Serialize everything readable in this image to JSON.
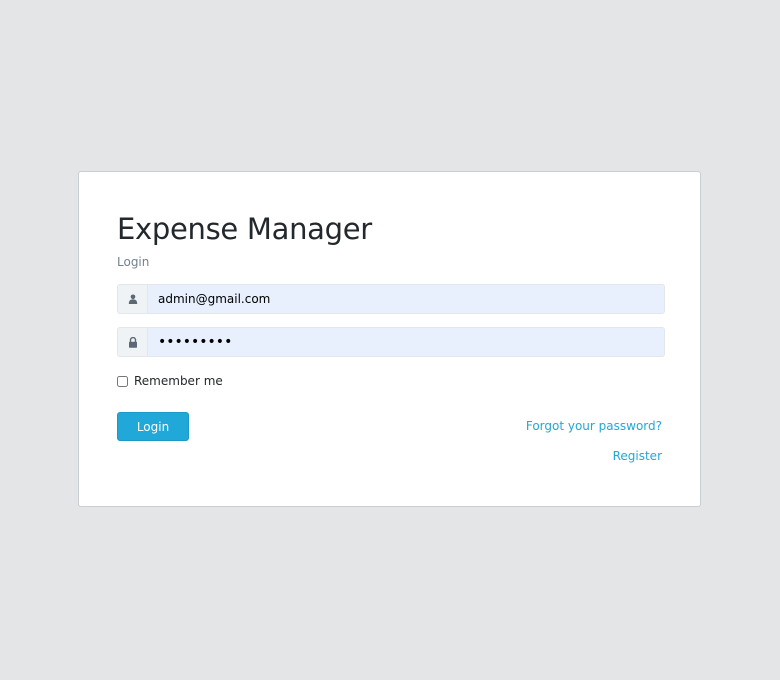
{
  "login": {
    "title": "Expense Manager",
    "subtitle": "Login",
    "email": {
      "icon": "user-icon",
      "value": "admin@gmail.com"
    },
    "password": {
      "icon": "lock-icon",
      "value": "123456789"
    },
    "remember_label": "Remember me",
    "remember_checked": false,
    "login_button_label": "Login",
    "forgot_password_label": "Forgot your password?",
    "register_label": "Register"
  },
  "colors": {
    "page_background": "#e4e5e6",
    "accent": "#20a8d8",
    "autofill_background": "#e8f0fe"
  }
}
